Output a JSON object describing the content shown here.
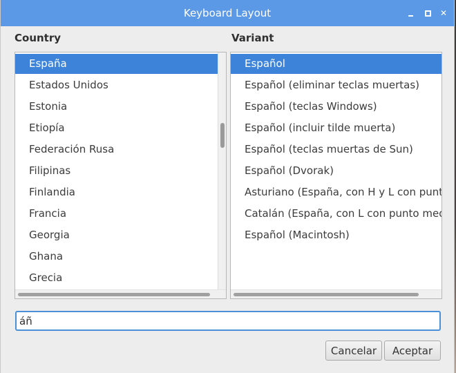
{
  "window": {
    "title": "Keyboard Layout"
  },
  "country": {
    "header": "Country",
    "items": [
      {
        "label": "España",
        "selected": true
      },
      {
        "label": "Estados Unidos",
        "selected": false
      },
      {
        "label": "Estonia",
        "selected": false
      },
      {
        "label": "Etiopía",
        "selected": false
      },
      {
        "label": "Federación Rusa",
        "selected": false
      },
      {
        "label": "Filipinas",
        "selected": false
      },
      {
        "label": "Finlandia",
        "selected": false
      },
      {
        "label": "Francia",
        "selected": false
      },
      {
        "label": "Georgia",
        "selected": false
      },
      {
        "label": "Ghana",
        "selected": false
      },
      {
        "label": "Grecia",
        "selected": false
      }
    ]
  },
  "variant": {
    "header": "Variant",
    "items": [
      {
        "label": "Español",
        "selected": true
      },
      {
        "label": "Español (eliminar teclas muertas)",
        "selected": false
      },
      {
        "label": "Español (teclas Windows)",
        "selected": false
      },
      {
        "label": "Español (incluir tilde muerta)",
        "selected": false
      },
      {
        "label": "Español (teclas muertas de Sun)",
        "selected": false
      },
      {
        "label": "Español (Dvorak)",
        "selected": false
      },
      {
        "label": "Asturiano (España, con H y L con punto b",
        "selected": false
      },
      {
        "label": "Catalán (España, con L con punto medio",
        "selected": false
      },
      {
        "label": "Español (Macintosh)",
        "selected": false
      }
    ]
  },
  "search": {
    "value": "áñ"
  },
  "buttons": {
    "cancel": "Cancelar",
    "accept": "Aceptar"
  },
  "colors": {
    "titlebar": "#5b99e6",
    "selection": "#3c83d9",
    "focus_border": "#4a90d9"
  }
}
